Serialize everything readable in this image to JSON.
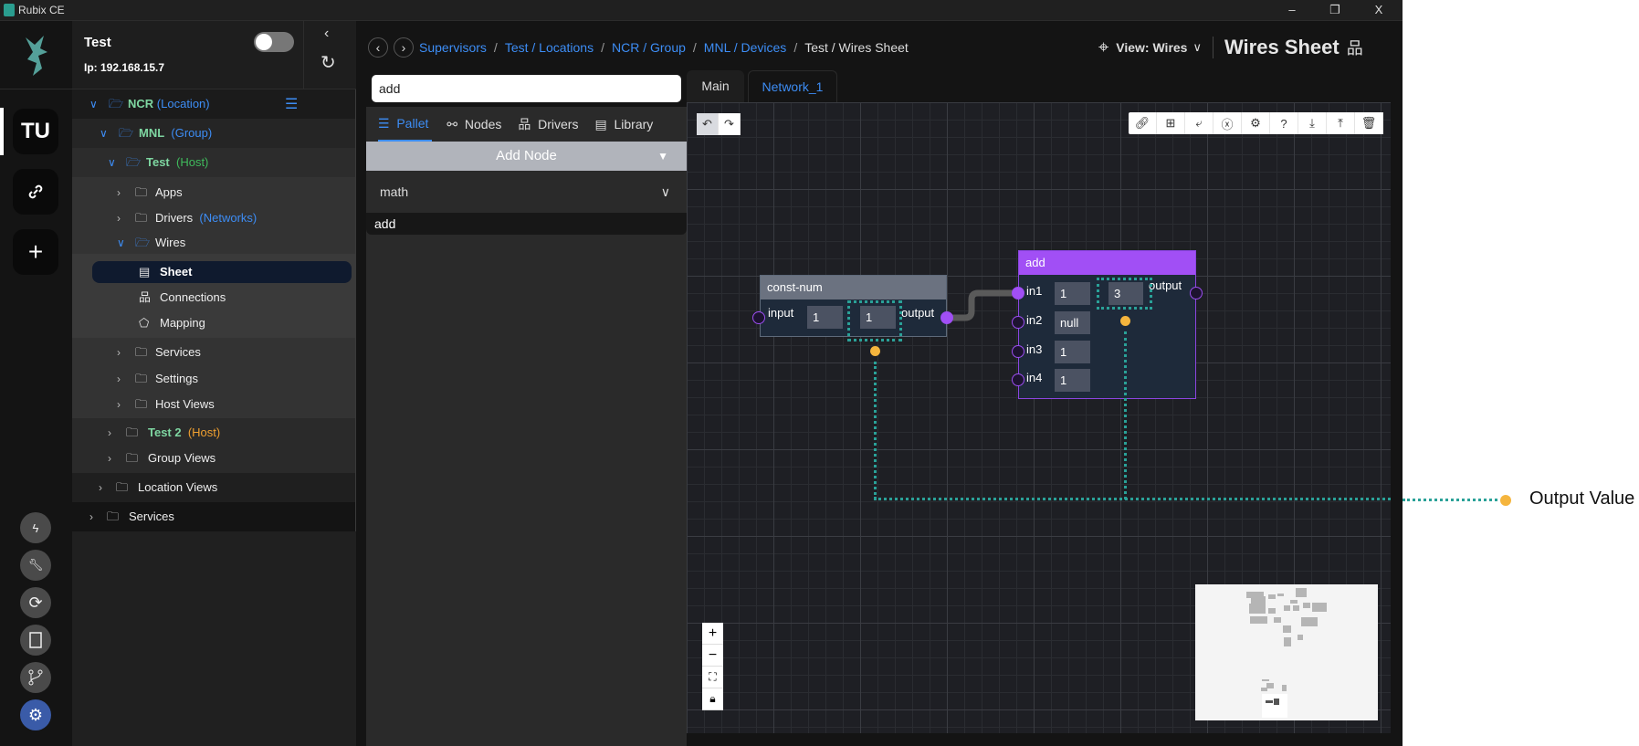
{
  "window": {
    "title": "Rubix CE",
    "minimize": "–",
    "maximize": "❐",
    "close": "X"
  },
  "rail": {
    "avatar": "TU"
  },
  "host": {
    "name": "Test",
    "ip": "Ip: 192.168.15.7",
    "enabled": false
  },
  "tree": [
    {
      "name": "NCR",
      "tag": "(Location)"
    },
    {
      "name": "MNL",
      "tag": "(Group)"
    },
    {
      "name": "Test",
      "tag": "(Host)"
    },
    {
      "name": "Apps"
    },
    {
      "name": "Drivers",
      "tag": "(Networks)"
    },
    {
      "name": "Wires"
    },
    {
      "name": "Sheet"
    },
    {
      "name": "Connections"
    },
    {
      "name": "Mapping"
    },
    {
      "name": "Services"
    },
    {
      "name": "Settings"
    },
    {
      "name": "Host Views"
    },
    {
      "name": "Test 2",
      "tag": "(Host)"
    },
    {
      "name": "Group Views"
    },
    {
      "name": "Location Views"
    },
    {
      "name": "Services"
    }
  ],
  "breadcrumb": [
    "Supervisors",
    "Test / Locations",
    "NCR / Group",
    "MNL / Devices",
    "Test / Wires Sheet"
  ],
  "header": {
    "view": "View: Wires",
    "title": "Wires Sheet"
  },
  "palette": {
    "search_value": "add",
    "tabs": [
      "Pallet",
      "Nodes",
      "Drivers",
      "Library"
    ],
    "active_tab": "Pallet",
    "add_node": "Add Node",
    "category": "math",
    "results": [
      "add"
    ]
  },
  "sheet_tabs": [
    "Main",
    "Network_1"
  ],
  "nodes": {
    "const_num": {
      "title": "const-num",
      "input_label": "input",
      "input_value": "1",
      "output_value": "1",
      "output_label": "output"
    },
    "add": {
      "title": "add",
      "inputs": [
        {
          "label": "in1",
          "value": "1"
        },
        {
          "label": "in2",
          "value": "null"
        },
        {
          "label": "in3",
          "value": "1"
        },
        {
          "label": "in4",
          "value": "1"
        }
      ],
      "output_value": "3",
      "output_label": "output"
    }
  },
  "annotation": {
    "label": "Output Value"
  },
  "colors": {
    "accent": "#3d8df5",
    "node_add": "#a14ff5",
    "node_const": "#6b7280",
    "wire_dots": "#2aa198",
    "output_dot": "#f5b53d"
  }
}
